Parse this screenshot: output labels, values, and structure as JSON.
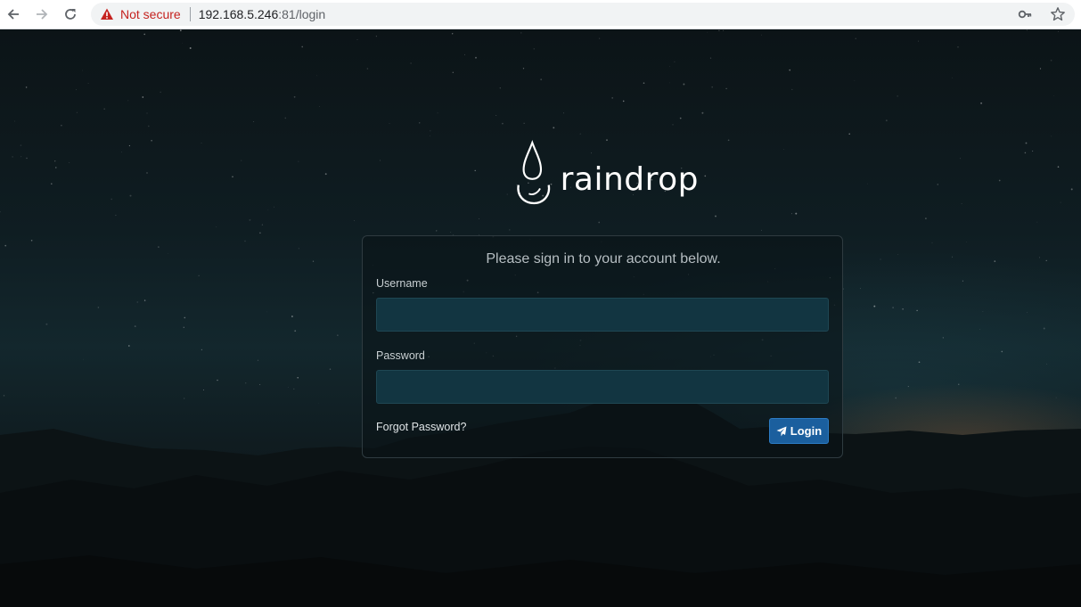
{
  "browser": {
    "security_label": "Not secure",
    "url_host": "192.168.5.246",
    "url_rest": ":81/login",
    "icons": {
      "back": "arrow-left-icon",
      "forward": "arrow-right-icon",
      "reload": "reload-icon",
      "warning": "warning-triangle-icon",
      "key": "key-icon",
      "bookmark": "star-icon"
    }
  },
  "logo": {
    "text": "raindrop",
    "icon": "raindrop-icon"
  },
  "login": {
    "subtitle": "Please sign in to your account below.",
    "username_label": "Username",
    "username_value": "",
    "password_label": "Password",
    "password_value": "",
    "forgot_label": "Forgot Password?",
    "submit_label": "Login",
    "submit_icon": "paper-plane-icon"
  },
  "colors": {
    "accent": "#1b5f9e",
    "input_bg": "#123541",
    "warning": "#c5221f"
  }
}
